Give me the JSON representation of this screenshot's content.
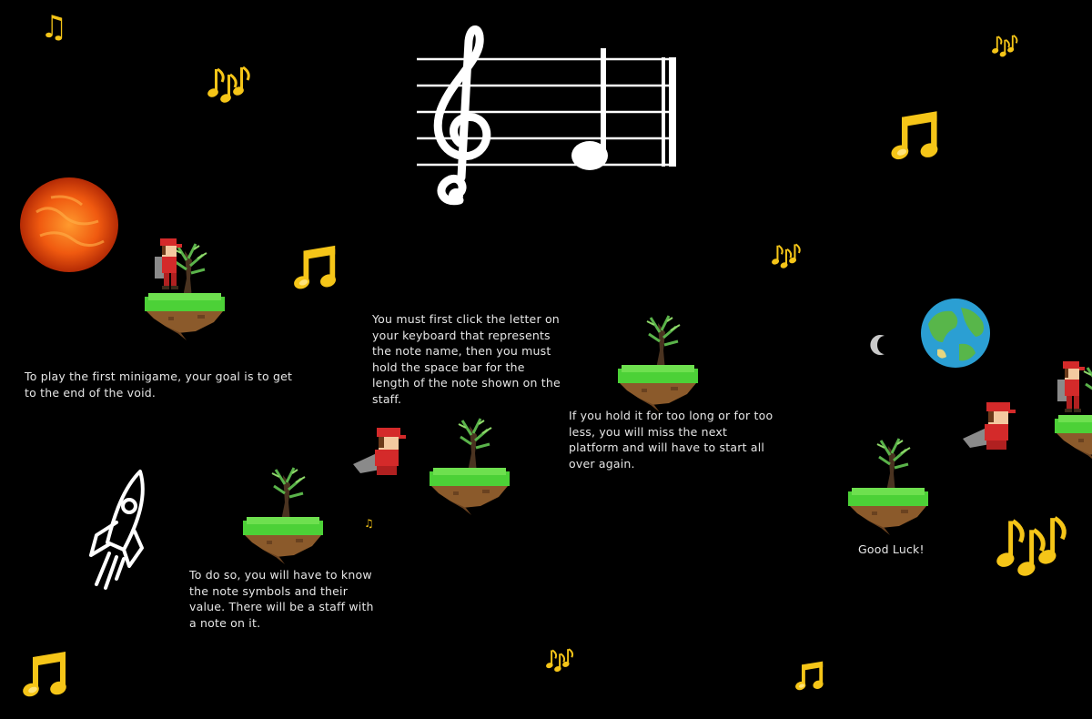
{
  "instructions": {
    "goal": "To play the first minigame, your goal is to get to the end of the void.",
    "know_notes": "To do so, you will have to know the note symbols and their value. There will be a staff with a note on it.",
    "click_letter": "You must first click the letter on your keyboard that represents the note name, then you must hold the space bar for the length of the note shown on the staff.",
    "timing": "If you hold it for too long or for too less, you will miss the next platform and will have to start all over again.",
    "good_luck": "Good Luck!"
  },
  "colors": {
    "background": "#000000",
    "text": "#e6e6e6",
    "note_gold": "#f5c518",
    "grass": "#4cd137",
    "dirt": "#8b5a2b"
  },
  "icons": [
    "treble-clef-staff",
    "half-note",
    "sun",
    "earth",
    "moon",
    "rocket",
    "music-note",
    "beamed-notes",
    "character",
    "floating-island"
  ]
}
